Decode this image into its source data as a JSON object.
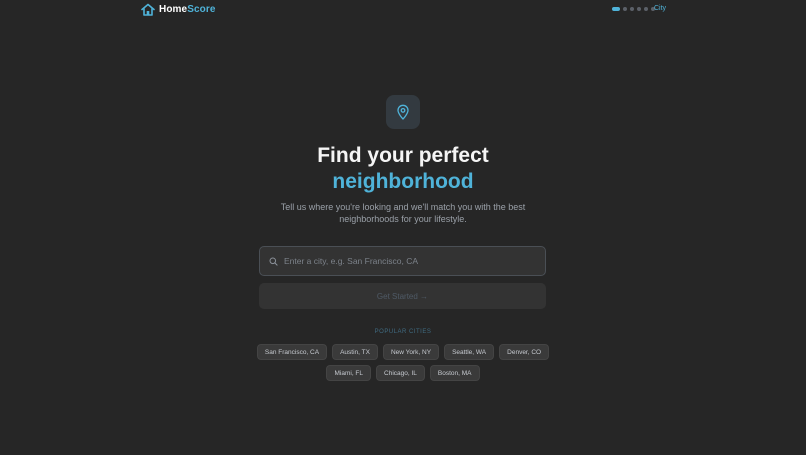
{
  "header": {
    "logo_prefix": "Home",
    "logo_suffix": "Score",
    "logo_icon": "house-icon",
    "progress": {
      "total_steps": 6,
      "current_step": 1
    },
    "step_label": "City"
  },
  "hero": {
    "icon": "map-pin-icon",
    "title_line1": "Find your perfect",
    "title_line2": "neighborhood",
    "subtitle": "Tell us where you're looking and we'll match you with the best neighborhoods for your lifestyle."
  },
  "search": {
    "placeholder": "Enter a city, e.g. San Francisco, CA",
    "value": "",
    "icon": "search-icon"
  },
  "cta": {
    "label": "Get Started →"
  },
  "popular": {
    "label": "POPULAR CITIES",
    "row1": [
      "San Francisco, CA",
      "Austin, TX",
      "New York, NY",
      "Seattle, WA",
      "Denver, CO"
    ],
    "row2": [
      "Miami, FL",
      "Chicago, IL",
      "Boston, MA"
    ]
  },
  "colors": {
    "background": "#262626",
    "accent": "#4fb3d9",
    "surface": "#333333",
    "chip": "#3a3a3a"
  }
}
